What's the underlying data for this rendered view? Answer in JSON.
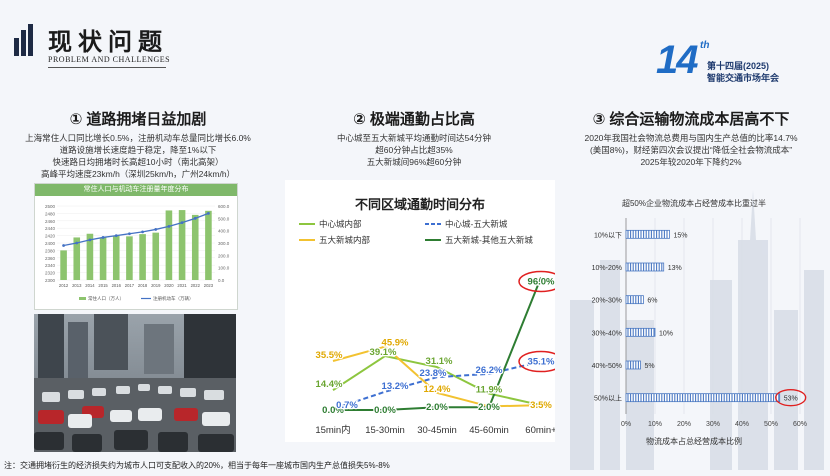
{
  "header": {
    "title": "现状问题",
    "subtitle": "PROBLEM AND CHALLENGES",
    "logo_number": "14",
    "logo_sup": "th",
    "logo_line1": "第十四届(2025)",
    "logo_line2": "智能交通市场年会"
  },
  "sections": [
    {
      "heading": "① 道路拥堵日益加剧",
      "lines": [
        "上海常住人口同比增长0.5%，注册机动车总量同比增长6.0%",
        "道路设施增长速度趋于稳定，降至1%以下",
        "快速路日均拥堵时长高超10小时（南北高架）",
        "高峰平均速度23km/h（深圳25km/h，广州24km/h）"
      ]
    },
    {
      "heading": "② 极端通勤占比高",
      "lines": [
        "中心城至五大新城平均通勤时间达54分钟",
        "超60分钟占比超35%",
        "五大新城间96%超60分钟"
      ]
    },
    {
      "heading": "③ 综合运输物流成本居高不下",
      "lines": [
        "2020年我国社会物流总费用与国内生产总值的比率14.7%",
        "(美国8%)，财经第四次会议提出“降低全社会物流成本”",
        "2025年较2020年下降约2%"
      ]
    }
  ],
  "footnote": "注：交通拥堵衍生的经济损失约为城市人口可支配收入的20%，相当于每年一座城市国内生产总值损失5%-8%",
  "chart_data": [
    {
      "type": "bar",
      "title": "常住人口与机动车注册量年度分布",
      "categories": [
        "2012",
        "2013",
        "2014",
        "2015",
        "2016",
        "2017",
        "2018",
        "2019",
        "2020",
        "2021",
        "2022",
        "2023"
      ],
      "y_left_ticks": [
        "2500",
        "2480",
        "2460",
        "2440",
        "2420",
        "2400",
        "2380",
        "2360",
        "2340",
        "2320",
        "2300"
      ],
      "y_right_ticks": [
        "600.0",
        "500.0",
        "400.0",
        "300.0",
        "200.0",
        "100.0",
        "0.0"
      ],
      "ylim_left": [
        2300,
        2500
      ],
      "ylim_right": [
        0,
        600
      ],
      "series": [
        {
          "name": "常住人口（万人）",
          "kind": "bar",
          "color": "#8dc46e",
          "values": [
            2380,
            2415,
            2425,
            2415,
            2420,
            2418,
            2424,
            2428,
            2488,
            2489,
            2476,
            2487
          ]
        },
        {
          "name": "注册机动车（万辆）",
          "kind": "line",
          "color": "#4472c4",
          "values": [
            280,
            300,
            325,
            345,
            360,
            375,
            390,
            410,
            435,
            465,
            500,
            540
          ]
        }
      ]
    },
    {
      "type": "line",
      "title": "不同区域通勤时间分布",
      "categories": [
        "15min内",
        "15-30min",
        "30-45min",
        "45-60min",
        "60min+"
      ],
      "ylim": [
        0,
        100
      ],
      "series": [
        {
          "name": "中心城内部",
          "color": "#8dc63f",
          "dash": false,
          "values": [
            14.4,
            39.1,
            31.1,
            11.9,
            3.5
          ]
        },
        {
          "name": "中心城-五大新城",
          "color": "#3d6fd1",
          "dash": true,
          "values": [
            0.7,
            13.2,
            23.8,
            26.2,
            35.1
          ]
        },
        {
          "name": "五大新城内部",
          "color": "#f2c230",
          "dash": false,
          "values": [
            35.5,
            45.9,
            12.4,
            2.6,
            3.5
          ]
        },
        {
          "name": "五大新城-其他五大新城",
          "color": "#2e7d32",
          "dash": false,
          "values": [
            0.0,
            0.0,
            2.0,
            2.0,
            96.0
          ]
        }
      ],
      "labels": [
        {
          "text": "35.5%",
          "color": "#e0a800",
          "cat": 0,
          "value": 35.5,
          "dx": -4,
          "dy": -6
        },
        {
          "text": "14.4%",
          "color": "#6aa531",
          "cat": 0,
          "value": 14.4,
          "dx": -4,
          "dy": -6
        },
        {
          "text": "0.0%",
          "color": "#2e7d32",
          "cat": 0,
          "value": 0.0,
          "dx": 0,
          "dy": 0
        },
        {
          "text": "0.7%",
          "color": "#3d6fd1",
          "cat": 0,
          "value": 0.7,
          "dx": 14,
          "dy": -4
        },
        {
          "text": "45.9%",
          "color": "#e0a800",
          "cat": 1,
          "value": 45.9,
          "dx": 10,
          "dy": -4
        },
        {
          "text": "39.1%",
          "color": "#6aa531",
          "cat": 1,
          "value": 39.1,
          "dx": -2,
          "dy": -4
        },
        {
          "text": "13.2%",
          "color": "#3d6fd1",
          "cat": 1,
          "value": 13.2,
          "dx": 10,
          "dy": -6
        },
        {
          "text": "0.0%",
          "color": "#2e7d32",
          "cat": 1,
          "value": 0.0,
          "dx": 0,
          "dy": 0
        },
        {
          "text": "31.1%",
          "color": "#6aa531",
          "cat": 2,
          "value": 31.1,
          "dx": 2,
          "dy": -6
        },
        {
          "text": "23.8%",
          "color": "#3d6fd1",
          "cat": 2,
          "value": 23.8,
          "dx": -4,
          "dy": -4
        },
        {
          "text": "12.4%",
          "color": "#e0a800",
          "cat": 2,
          "value": 12.4,
          "dx": 0,
          "dy": -4
        },
        {
          "text": "2.0%",
          "color": "#2e7d32",
          "cat": 2,
          "value": 2.0,
          "dx": 0,
          "dy": 0
        },
        {
          "text": "26.2%",
          "color": "#3d6fd1",
          "cat": 3,
          "value": 26.2,
          "dx": 0,
          "dy": -4
        },
        {
          "text": "11.9%",
          "color": "#6aa531",
          "cat": 3,
          "value": 11.9,
          "dx": 0,
          "dy": -4
        },
        {
          "text": "2.0%",
          "color": "#2e7d32",
          "cat": 3,
          "value": 2.0,
          "dx": 0,
          "dy": 0
        },
        {
          "text": "96.0%",
          "color": "#2e7d32",
          "cat": 4,
          "value": 96.0,
          "dx": 0,
          "dy": 4
        },
        {
          "text": "35.1%",
          "color": "#3d6fd1",
          "cat": 4,
          "value": 35.1,
          "dx": 0,
          "dy": 0
        },
        {
          "text": "3.5%",
          "color": "#e0a800",
          "cat": 4,
          "value": 3.5,
          "dx": 0,
          "dy": 0
        }
      ]
    },
    {
      "type": "bar",
      "orientation": "horizontal",
      "title": "超50%企业物流成本占经营成本比重过半",
      "xlabel": "物流成本占总经营成本比例",
      "categories": [
        "10%以下",
        "10%-20%",
        "20%-30%",
        "30%-40%",
        "40%-50%",
        "50%以上"
      ],
      "values": [
        15,
        13,
        6,
        10,
        5,
        53
      ],
      "value_labels": [
        "15%",
        "13%",
        "6%",
        "10%",
        "5%",
        "53%"
      ],
      "x_ticks": [
        "0%",
        "10%",
        "20%",
        "30%",
        "40%",
        "50%",
        "60%"
      ],
      "xlim": [
        0,
        60
      ],
      "color": "#4a78c2"
    }
  ]
}
